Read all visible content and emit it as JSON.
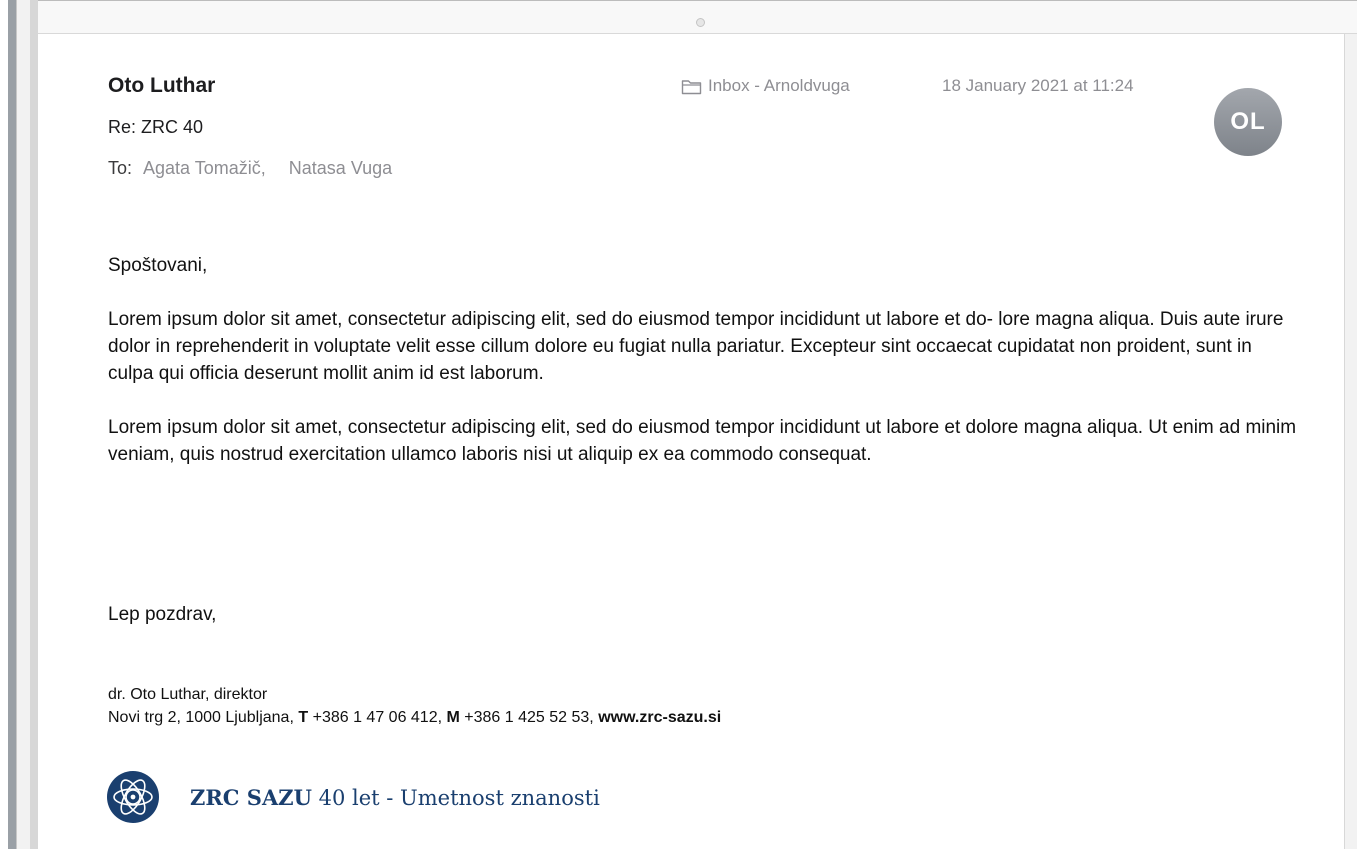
{
  "colors": {
    "brand_blue": "#1a3f6f",
    "secondary_text": "#8e8e93",
    "avatar_gray": "#8b8f95"
  },
  "message": {
    "sender": "Oto Luthar",
    "subject": "Re: ZRC 40",
    "to_label": "To:",
    "recipients": [
      "Agata Tomažič,",
      "Natasa Vuga"
    ],
    "mailbox": "Inbox - Arnoldvuga",
    "mailbox_icon": "folder-icon",
    "date": "18 January 2021 at 11:24",
    "avatar_initials": "OL"
  },
  "body": {
    "greeting": "Spoštovani,",
    "paragraphs": [
      "Lorem ipsum dolor sit amet, consectetur adipiscing elit, sed do eiusmod tempor incididunt ut labore et do- lore magna aliqua. Duis aute irure dolor in reprehenderit in voluptate velit esse cillum dolore eu fugiat nulla pariatur. Excepteur sint occaecat cupidatat non proident, sunt in culpa qui officia deserunt mollit anim id est laborum.",
      "Lorem ipsum dolor sit amet, consectetur adipiscing elit, sed do eiusmod tempor incididunt ut labore et dolore magna aliqua. Ut enim ad minim veniam, quis nostrud exercitation ullamco laboris nisi ut aliquip ex ea commodo consequat."
    ],
    "closing": "Lep pozdrav,"
  },
  "signature": {
    "name_line": "dr. Oto Luthar, direktor",
    "address": "Novi trg 2, 1000 Ljubljana,",
    "phone_label": "T",
    "phone": "+386 1 47 06 412,",
    "mobile_label": "M",
    "mobile": "+386 1 425 52 53,",
    "website": "www.zrc-sazu.si",
    "logo_brand": "ZRC SAZU",
    "logo_tagline": "40 let - Umetnost znanosti",
    "logo_icon": "zrc-sazu-logo-icon"
  }
}
